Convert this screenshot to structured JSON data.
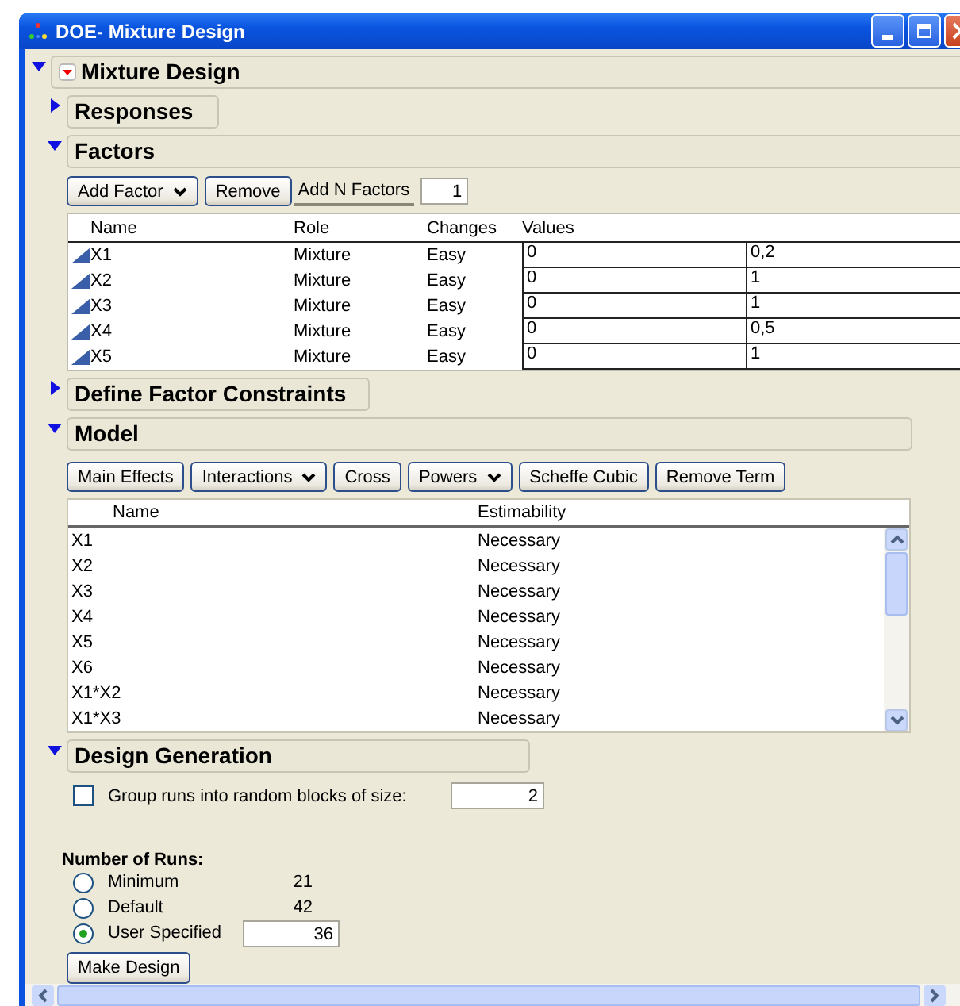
{
  "window": {
    "title": "DOE- Mixture Design"
  },
  "outline": {
    "title": "Mixture Design",
    "expanded": true
  },
  "responses": {
    "title": "Responses",
    "expanded": false
  },
  "factors": {
    "title": "Factors",
    "expanded": true,
    "buttons": [
      {
        "label": "Add Factor",
        "kind": "dropdown"
      },
      {
        "label": "Remove",
        "kind": "button"
      },
      {
        "label": "Add N Factors",
        "kind": "flat"
      }
    ],
    "n_factors": "1",
    "columns": [
      "Name",
      "Role",
      "Changes",
      "Values"
    ],
    "rows": [
      {
        "name": "X1",
        "role": "Mixture",
        "changes": "Easy",
        "low": "0",
        "high": "0,2"
      },
      {
        "name": "X2",
        "role": "Mixture",
        "changes": "Easy",
        "low": "0",
        "high": "1"
      },
      {
        "name": "X3",
        "role": "Mixture",
        "changes": "Easy",
        "low": "0",
        "high": "1"
      },
      {
        "name": "X4",
        "role": "Mixture",
        "changes": "Easy",
        "low": "0",
        "high": "0,5"
      },
      {
        "name": "X5",
        "role": "Mixture",
        "changes": "Easy",
        "low": "0",
        "high": "1"
      }
    ]
  },
  "constraints": {
    "title": "Define Factor Constraints",
    "expanded": false
  },
  "model": {
    "title": "Model",
    "expanded": true,
    "buttons": [
      {
        "label": "Main Effects",
        "kind": "button"
      },
      {
        "label": "Interactions",
        "kind": "dropdown"
      },
      {
        "label": "Cross",
        "kind": "button"
      },
      {
        "label": "Powers",
        "kind": "dropdown"
      },
      {
        "label": "Scheffe Cubic",
        "kind": "button"
      },
      {
        "label": "Remove Term",
        "kind": "button"
      }
    ],
    "columns": [
      "Name",
      "Estimability"
    ],
    "rows": [
      {
        "name": "X1",
        "estimability": "Necessary"
      },
      {
        "name": "X2",
        "estimability": "Necessary"
      },
      {
        "name": "X3",
        "estimability": "Necessary"
      },
      {
        "name": "X4",
        "estimability": "Necessary"
      },
      {
        "name": "X5",
        "estimability": "Necessary"
      },
      {
        "name": "X6",
        "estimability": "Necessary"
      },
      {
        "name": "X1*X2",
        "estimability": "Necessary"
      },
      {
        "name": "X1*X3",
        "estimability": "Necessary"
      }
    ]
  },
  "design_generation": {
    "title": "Design Generation",
    "expanded": true,
    "group_runs": {
      "label": "Group runs into random blocks of size:",
      "checked": false,
      "value": "2"
    },
    "runs_title": "Number of Runs:",
    "runs": [
      {
        "label": "Minimum",
        "kind": "text",
        "value": "21",
        "selected": false
      },
      {
        "label": "Default",
        "kind": "text",
        "value": "42",
        "selected": false
      },
      {
        "label": "User Specified",
        "kind": "field",
        "value": "36",
        "selected": true
      }
    ],
    "make_design": "Make Design"
  }
}
